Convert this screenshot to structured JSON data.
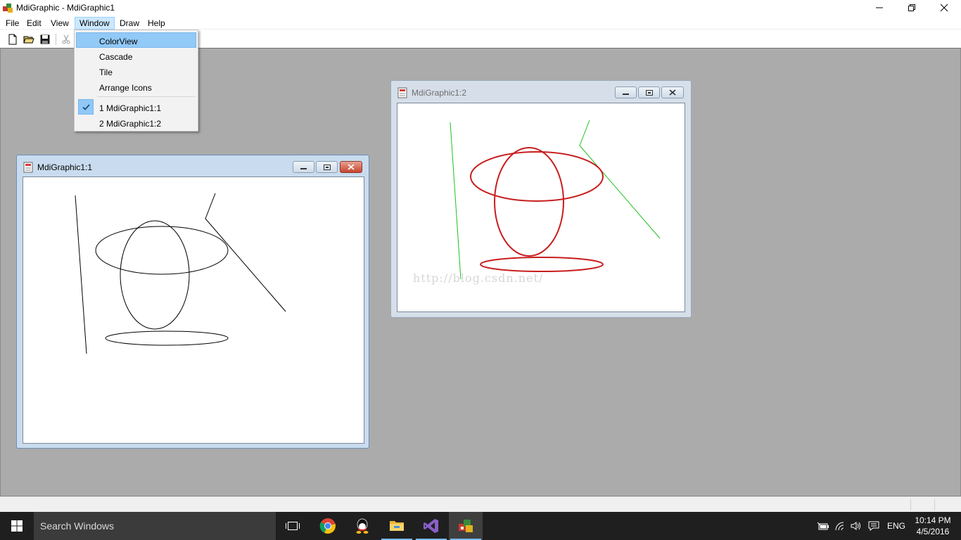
{
  "app": {
    "title": "MdiGraphic - MdiGraphic1"
  },
  "menu": [
    "File",
    "Edit",
    "View",
    "Window",
    "Draw",
    "Help"
  ],
  "window_menu": {
    "items": [
      "ColorView",
      "Cascade",
      "Tile",
      "Arrange Icons"
    ],
    "windows": [
      "1 MdiGraphic1:1",
      "2 MdiGraphic1:2"
    ],
    "checked_index": 0,
    "highlighted": "ColorView"
  },
  "children": [
    {
      "title": "MdiGraphic1:1",
      "active": true,
      "stroke": "#000000",
      "line_stroke": "#000000"
    },
    {
      "title": "MdiGraphic1:2",
      "active": false,
      "stroke": "#cc1f1f",
      "line_stroke": "#20c020",
      "watermark": "http://blog.csdn.net/"
    }
  ],
  "taskbar": {
    "search_placeholder": "Search Windows",
    "lang": "ENG",
    "time": "10:14 PM",
    "date": "4/5/2016",
    "apps": [
      "task-view-icon",
      "chrome-icon",
      "qq-icon",
      "file-explorer-icon",
      "visual-studio-icon",
      "mdi-graphic-app-icon"
    ]
  },
  "colors": {
    "mdi_bg": "#ababab",
    "accent": "#91c9f7",
    "taskbar": "#1f1f1f"
  }
}
